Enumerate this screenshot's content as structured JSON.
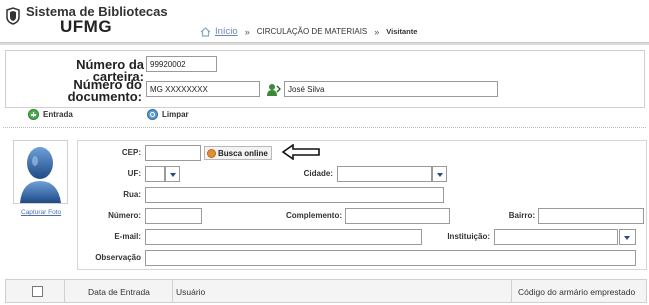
{
  "header": {
    "logo_line1": "Sistema de Bibliotecas",
    "logo_line2": "UFMG",
    "breadcrumb": {
      "home_label": "Início",
      "section": "CIRCULAÇÃO DE MATERIAIS",
      "current": "Visitante"
    }
  },
  "form": {
    "carteira_label": "Número da carteira:",
    "carteira_value": "99920002",
    "documento_label_line1": "Número do",
    "documento_label_line2": "documento:",
    "documento_value": "MG XXXXXXXX",
    "nome_value": "José Silva"
  },
  "actions": {
    "entrada_label": "Entrada",
    "limpar_label": "Limpar"
  },
  "photo": {
    "capture_label": "Capturar Foto"
  },
  "address": {
    "cep_label": "CEP:",
    "cep_value": "",
    "busca_label": "Busca online",
    "uf_label": "UF:",
    "uf_value": "",
    "cidade_label": "Cidade:",
    "cidade_value": "",
    "rua_label": "Rua:",
    "rua_value": "",
    "numero_label": "Número:",
    "numero_value": "",
    "complemento_label": "Complemento:",
    "complemento_value": "",
    "bairro_label": "Bairro:",
    "bairro_value": "",
    "email_label": "E-mail:",
    "email_value": "",
    "instituicao_label": "Instituição:",
    "instituicao_value": "",
    "observacao_label": "Observação",
    "observacao_value": ""
  },
  "table": {
    "columns": [
      "Data de Entrada",
      "Usuário",
      "Código do armário emprestado"
    ]
  },
  "colors": {
    "link": "#4a6db0",
    "select_arrow": "#2c4a7a",
    "busca_icon": "#e58f33",
    "entrada_icon": "#4cae4c",
    "limpar_icon": "#5b9bd5"
  }
}
